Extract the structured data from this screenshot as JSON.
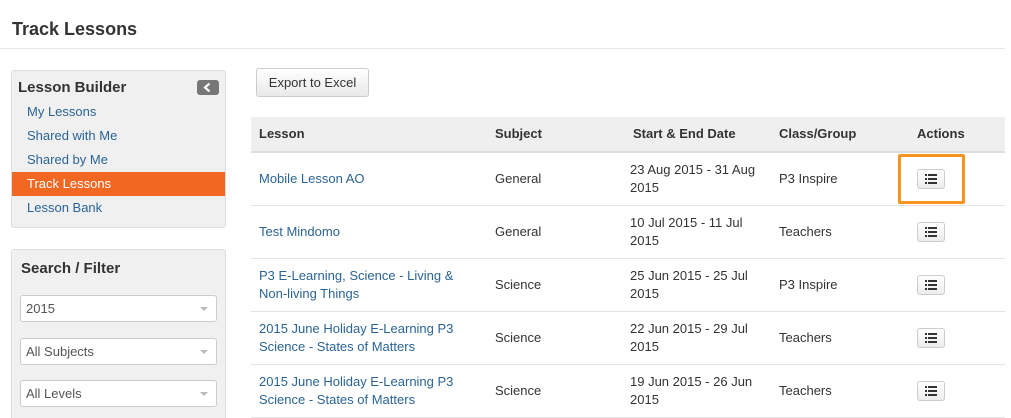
{
  "page": {
    "title": "Track Lessons"
  },
  "sidebar": {
    "builder_title": "Lesson Builder",
    "nav": [
      {
        "label": "My Lessons",
        "active": false
      },
      {
        "label": "Shared with Me",
        "active": false
      },
      {
        "label": "Shared by Me",
        "active": false
      },
      {
        "label": "Track Lessons",
        "active": true
      },
      {
        "label": "Lesson Bank",
        "active": false
      }
    ],
    "filter_title": "Search / Filter",
    "filters": {
      "year": "2015",
      "subjects": "All Subjects",
      "levels": "All Levels"
    }
  },
  "toolbar": {
    "export_label": "Export to Excel"
  },
  "table": {
    "headers": {
      "lesson": "Lesson",
      "subject": "Subject",
      "dates": "Start & End Date",
      "class": "Class/Group",
      "actions": "Actions"
    },
    "rows": [
      {
        "lesson": "Mobile Lesson AO",
        "subject": "General",
        "dates": "23 Aug 2015 - 31 Aug 2015",
        "class": "P3 Inspire"
      },
      {
        "lesson": "Test Mindomo",
        "subject": "General",
        "dates": "10 Jul 2015 - 11 Jul 2015",
        "class": "Teachers"
      },
      {
        "lesson": "P3 E-Learning, Science - Living & Non-living Things",
        "subject": "Science",
        "dates": "25 Jun 2015 - 25 Jul 2015",
        "class": "P3 Inspire"
      },
      {
        "lesson": "2015 June Holiday E-Learning P3 Science - States of Matters",
        "subject": "Science",
        "dates": "22 Jun 2015 - 29 Jul 2015",
        "class": "Teachers"
      },
      {
        "lesson": "2015 June Holiday E-Learning P3 Science - States of Matters",
        "subject": "Science",
        "dates": "19 Jun 2015 - 26 Jun 2015",
        "class": "Teachers"
      }
    ]
  },
  "colors": {
    "accent": "#f26722",
    "highlight": "#f7941d",
    "link": "#2a6496"
  },
  "icons": {
    "collapse": "chevron-left-icon",
    "action": "list-icon"
  }
}
